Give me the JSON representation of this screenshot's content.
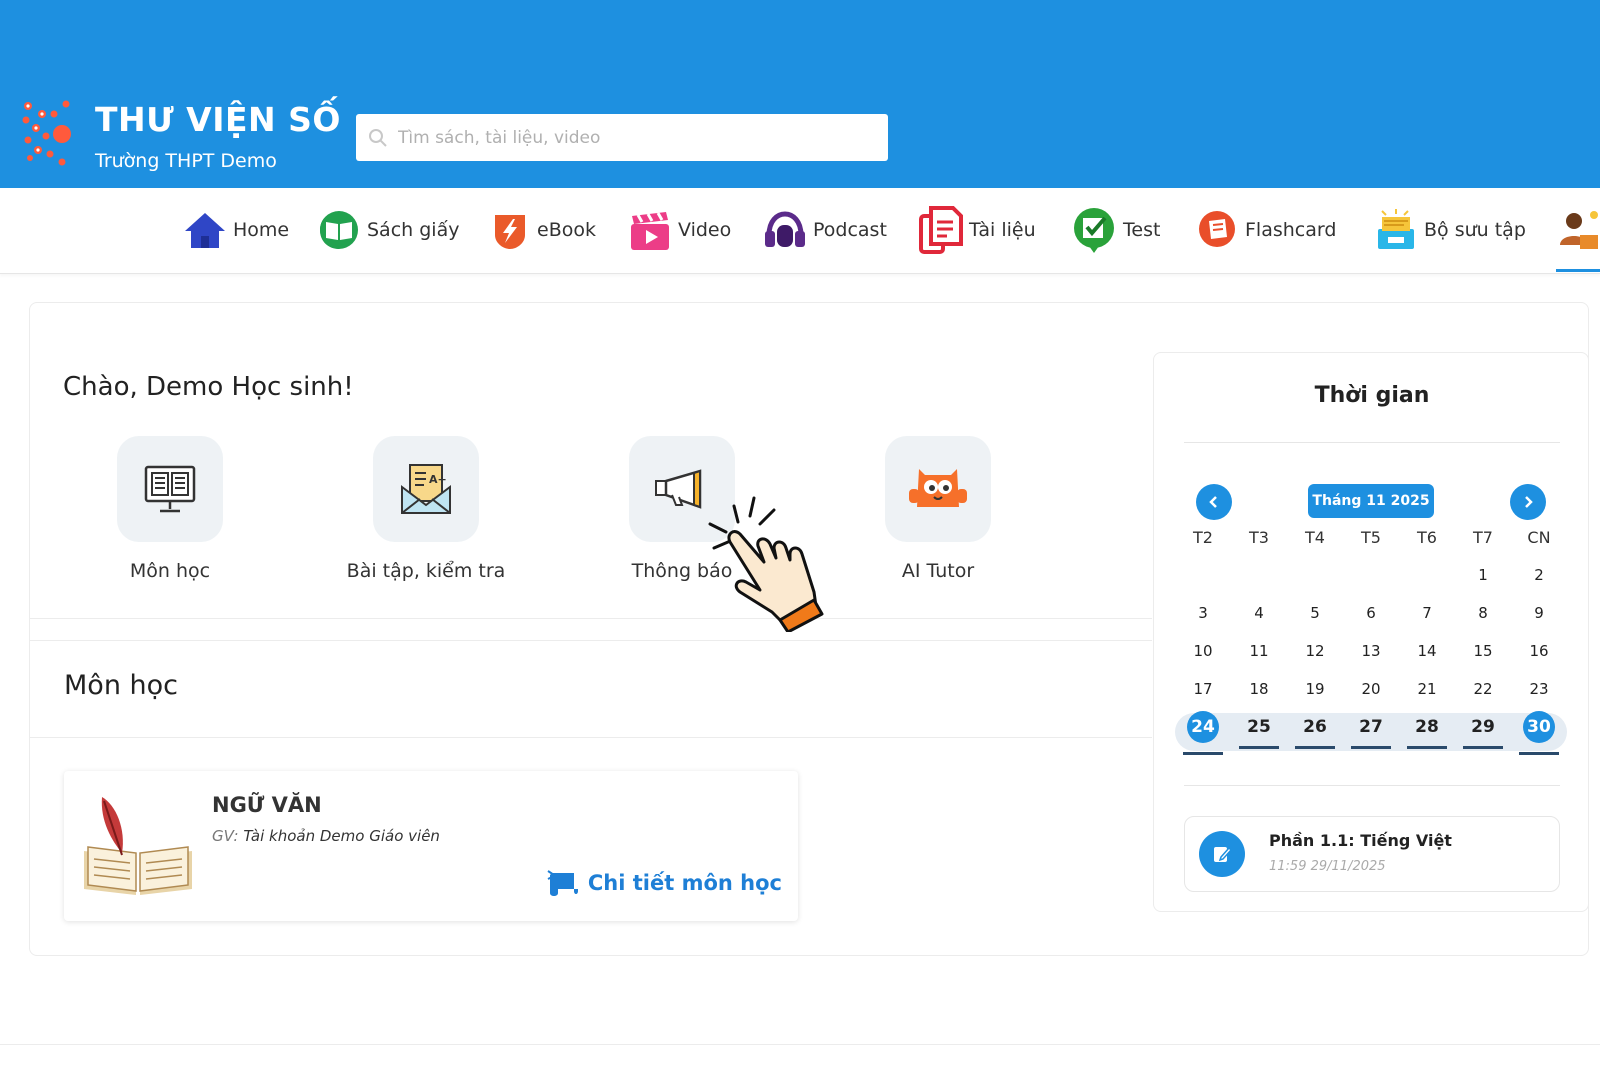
{
  "header": {
    "brand_title": "THƯ VIỆN SỐ",
    "brand_subtitle": "Trường THPT Demo",
    "search_placeholder": "Tìm sách, tài liệu, video"
  },
  "nav": {
    "items": [
      {
        "label": "Home",
        "icon": "home-icon"
      },
      {
        "label": "Sách giấy",
        "icon": "book-icon"
      },
      {
        "label": "eBook",
        "icon": "ebook-icon"
      },
      {
        "label": "Video",
        "icon": "video-icon"
      },
      {
        "label": "Podcast",
        "icon": "headphones-icon"
      },
      {
        "label": "Tài liệu",
        "icon": "document-icon"
      },
      {
        "label": "Test",
        "icon": "test-icon"
      },
      {
        "label": "Flashcard",
        "icon": "flashcard-icon"
      },
      {
        "label": "Bộ sưu tập",
        "icon": "collection-icon"
      }
    ]
  },
  "dashboard": {
    "greeting": "Chào, Demo Học sinh!",
    "tiles": [
      {
        "label": "Môn học",
        "icon": "monitor-book-icon"
      },
      {
        "label": "Bài tập, kiểm tra",
        "icon": "envelope-homework-icon"
      },
      {
        "label": "Thông báo",
        "icon": "megaphone-icon"
      },
      {
        "label": "AI Tutor",
        "icon": "robot-mascot-icon"
      }
    ]
  },
  "subjects": {
    "section_title": "Môn học",
    "items": [
      {
        "name": "NGỮ VĂN",
        "teacher_prefix": "GV:",
        "teacher": "Tài khoản Demo Giáo viên",
        "detail_label": "Chi tiết môn học"
      }
    ]
  },
  "calendar": {
    "title": "Thời gian",
    "month_label": "Tháng 11 2025",
    "weekdays": [
      "T2",
      "T3",
      "T4",
      "T5",
      "T6",
      "T7",
      "CN"
    ],
    "weeks": [
      [
        "",
        "",
        "",
        "",
        "",
        "1",
        "2"
      ],
      [
        "3",
        "4",
        "5",
        "6",
        "7",
        "8",
        "9"
      ],
      [
        "10",
        "11",
        "12",
        "13",
        "14",
        "15",
        "16"
      ],
      [
        "17",
        "18",
        "19",
        "20",
        "21",
        "22",
        "23"
      ],
      [
        "24",
        "25",
        "26",
        "27",
        "28",
        "29",
        "30"
      ]
    ],
    "selected_week_index": 4,
    "highlighted_days": [
      "24",
      "30"
    ],
    "event": {
      "title": "Phần 1.1: Tiếng Việt",
      "time": "11:59 29/11/2025"
    }
  },
  "colors": {
    "brand_blue": "#1e90e0",
    "link_blue": "#1e7fd6",
    "tile_bg": "#eef2f5"
  }
}
